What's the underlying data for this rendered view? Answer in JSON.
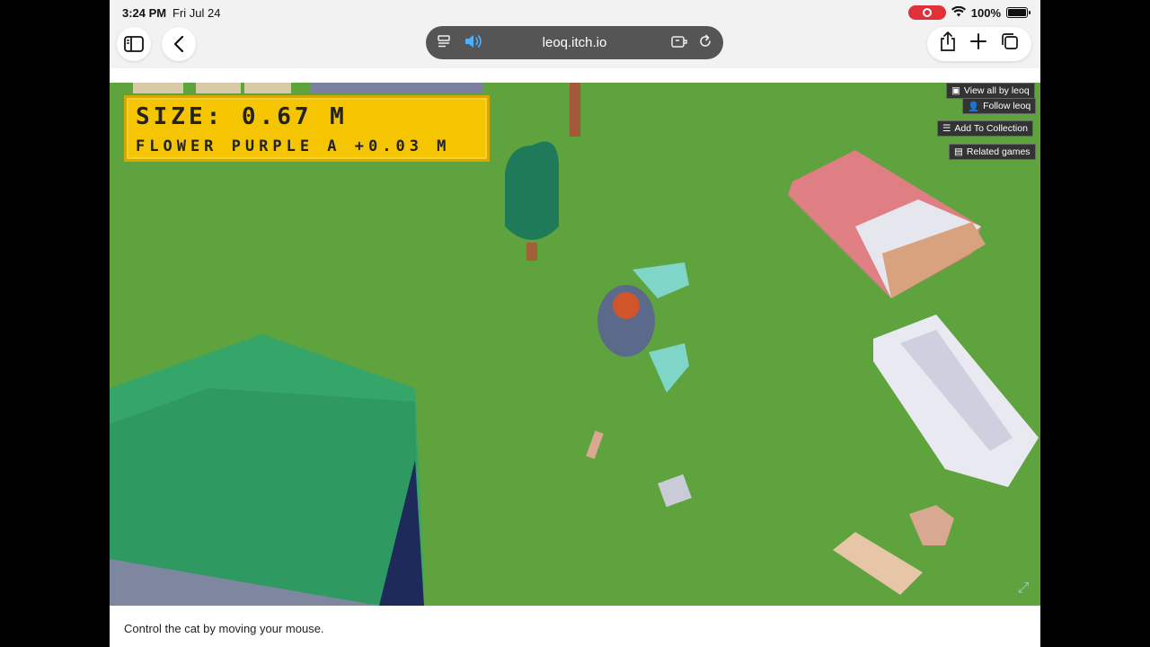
{
  "status": {
    "time": "3:24 PM",
    "date": "Fri Jul 24",
    "battery": "100%"
  },
  "browser": {
    "url": "leoq.itch.io"
  },
  "game": {
    "hud_size": "SIZE: 0.67 M",
    "hud_item": "FLOWER PURPLE A +0.03 M"
  },
  "itch": {
    "view_all": "View all by leoq",
    "follow": "Follow leoq",
    "add_collection": "Add To Collection",
    "related": "Related games"
  },
  "page": {
    "caption": "Control the cat by moving your mouse."
  }
}
